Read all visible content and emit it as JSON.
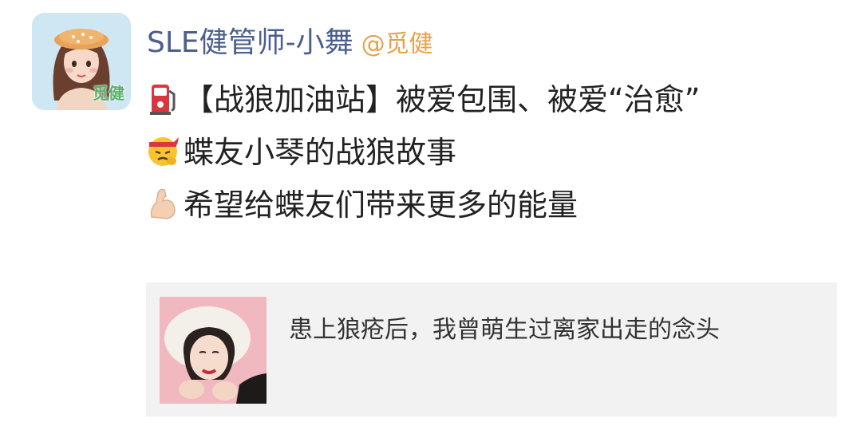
{
  "author": {
    "display_name": "SLE健管师-小舞",
    "handle": "@觅健",
    "avatar_tag": "觅健",
    "avatar_icon": "cartoon-girl-avatar"
  },
  "post": {
    "line1_text": "【战狼加油站】被爱包围、被爱“治愈”",
    "line1_icon": "fuel-pump-icon",
    "line2_text": "蝶友小琴的战狼故事",
    "line2_icon": "determined-face-headband-icon",
    "line3_text": "希望给蝶友们带来更多的能量",
    "line3_icon": "flexed-biceps-icon"
  },
  "card": {
    "title": "患上狼疮后，我曾萌生过离家出走的念头",
    "thumbnail_icon": "woman-portrait-thumbnail"
  },
  "colors": {
    "name": "#4a5f8e",
    "handle": "#e6a24a",
    "card_bg": "#f2f2f2",
    "avatar_bg": "#cfe7f3",
    "avatar_tag": "#56b26a"
  }
}
